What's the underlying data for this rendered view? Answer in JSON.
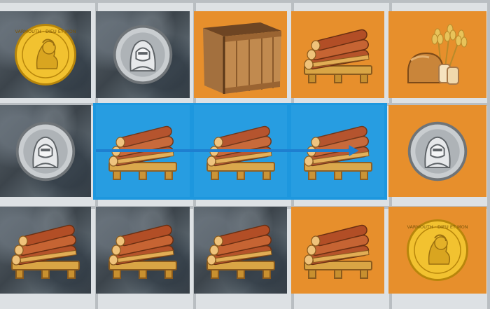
{
  "board": {
    "rows": 3,
    "cols": 5,
    "selected_path": [
      [
        1,
        1
      ],
      [
        1,
        2
      ],
      [
        1,
        3
      ]
    ],
    "tiles": [
      [
        {
          "bg": "stone",
          "item": "gold-coin"
        },
        {
          "bg": "stone",
          "item": "silver-coin"
        },
        {
          "bg": "orange",
          "item": "wooden-crate"
        },
        {
          "bg": "orange",
          "item": "log-pile"
        },
        {
          "bg": "orange",
          "item": "bread-wheat"
        }
      ],
      [
        {
          "bg": "stone",
          "item": "silver-coin"
        },
        {
          "bg": "blue",
          "item": "log-pile"
        },
        {
          "bg": "blue",
          "item": "log-pile"
        },
        {
          "bg": "blue",
          "item": "log-pile"
        },
        {
          "bg": "orange",
          "item": "silver-coin"
        }
      ],
      [
        {
          "bg": "stone",
          "item": "log-pile"
        },
        {
          "bg": "stone",
          "item": "log-pile"
        },
        {
          "bg": "stone",
          "item": "log-pile"
        },
        {
          "bg": "orange",
          "item": "log-pile"
        },
        {
          "bg": "orange",
          "item": "gold-coin"
        }
      ]
    ]
  },
  "colors": {
    "orange_tile": "#e78f2c",
    "selection_blue": "#1f9ae0",
    "path_arrow": "#1e7fd0"
  },
  "coin_inscription": "VARMOUTH · DIEU ET MON"
}
